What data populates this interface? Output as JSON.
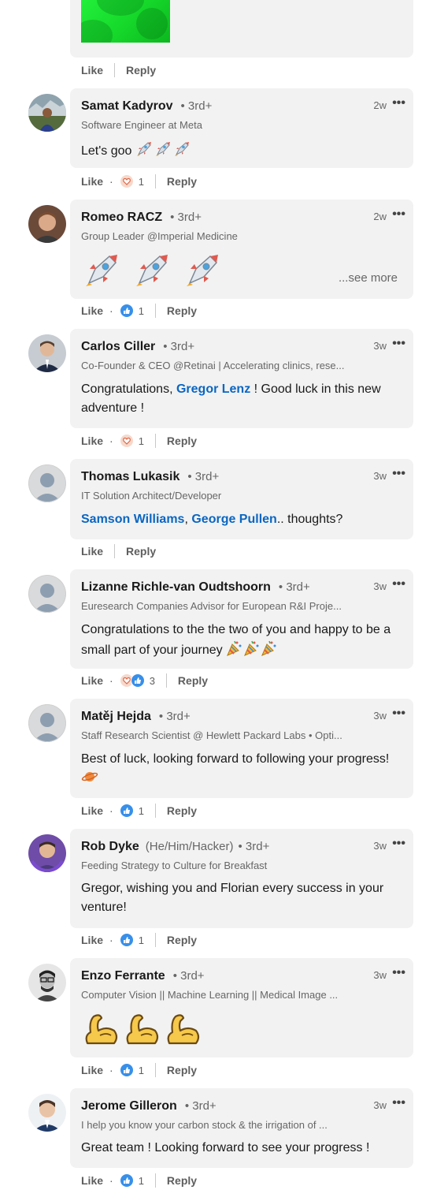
{
  "top_comment": {
    "like": "Like",
    "reply": "Reply"
  },
  "comments": [
    {
      "name": "Samat Kadyrov",
      "degree": "• 3rd+",
      "headline": "Software Engineer at Meta",
      "time": "2w",
      "body_text": "Let's goo",
      "like": "Like",
      "reply": "Reply",
      "reaction_count": "1",
      "reactions": [
        "love-icon"
      ]
    },
    {
      "name": "Romeo RACZ",
      "degree": "• 3rd+",
      "headline": "Group Leader @Imperial Medicine",
      "time": "2w",
      "see_more": "...see more",
      "like": "Like",
      "reply": "Reply",
      "reaction_count": "1",
      "reactions": [
        "like-icon"
      ]
    },
    {
      "name": "Carlos Ciller",
      "degree": "• 3rd+",
      "headline": "Co-Founder & CEO @Retinai | Accelerating clinics, rese...",
      "time": "3w",
      "body_pre": "Congratulations, ",
      "mention": "Gregor Lenz",
      "body_post": " ! Good luck in this new adventure !",
      "like": "Like",
      "reply": "Reply",
      "reaction_count": "1",
      "reactions": [
        "love-icon"
      ]
    },
    {
      "name": "Thomas Lukasik",
      "degree": "• 3rd+",
      "headline": "IT Solution Architect/Developer",
      "time": "3w",
      "mention_1": "Samson Williams",
      "sep": ", ",
      "mention_2": "George Pullen",
      "body_post": ".. thoughts?",
      "like": "Like",
      "reply": "Reply"
    },
    {
      "name": "Lizanne Richle-van Oudtshoorn",
      "degree": "• 3rd+",
      "headline": "Euresearch Companies Advisor for European R&I Proje...",
      "time": "3w",
      "body_text": "Congratulations to the the two of you and happy to be a small part of your journey",
      "like": "Like",
      "reply": "Reply",
      "reaction_count": "3",
      "reactions": [
        "love-icon",
        "like-icon"
      ]
    },
    {
      "name": "Matěj Hejda",
      "degree": "• 3rd+",
      "headline": "Staff Research Scientist @ Hewlett Packard Labs • Opti...",
      "time": "3w",
      "body_text": "Best of luck, looking forward to following your progress!",
      "like": "Like",
      "reply": "Reply",
      "reaction_count": "1",
      "reactions": [
        "like-icon"
      ]
    },
    {
      "name": "Rob Dyke",
      "pronouns": "(He/Him/Hacker)",
      "degree": "• 3rd+",
      "headline": "Feeding Strategy to Culture for Breakfast",
      "time": "3w",
      "body_text": "Gregor, wishing you and Florian every success in your venture!",
      "like": "Like",
      "reply": "Reply",
      "reaction_count": "1",
      "reactions": [
        "like-icon"
      ]
    },
    {
      "name": "Enzo Ferrante",
      "degree": "• 3rd+",
      "headline": "Computer Vision || Machine Learning || Medical Image ...",
      "time": "3w",
      "like": "Like",
      "reply": "Reply",
      "reaction_count": "1",
      "reactions": [
        "like-icon"
      ]
    },
    {
      "name": "Jerome Gilleron",
      "degree": "• 3rd+",
      "headline": "I help you know your carbon stock & the irrigation of ...",
      "time": "3w",
      "body_text": "Great team ! Looking forward to see your progress !",
      "like": "Like",
      "reply": "Reply",
      "reaction_count": "1",
      "reactions": [
        "like-icon"
      ]
    }
  ],
  "more_icon": "•••",
  "colors": {
    "bubble": "#f2f2f2",
    "mention": "#0a66c2",
    "like_blue": "#378fe9",
    "love_red": "#e06847"
  }
}
